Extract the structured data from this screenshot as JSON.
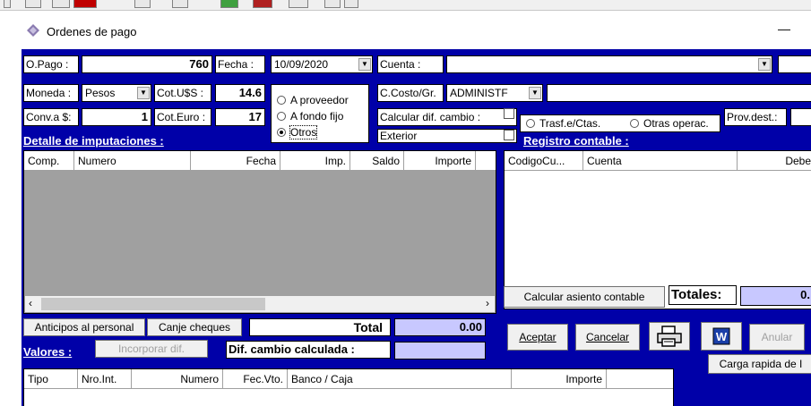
{
  "window": {
    "title": "Ordenes de pago",
    "minimize_glyph": "—"
  },
  "header": {
    "opago_label": "O.Pago :",
    "opago_value": "760",
    "fecha_label": "Fecha :",
    "fecha_value": "10/09/2020",
    "cuenta_label": "Cuenta :",
    "cuenta_value": "",
    "moneda_label": "Moneda :",
    "moneda_value": "Pesos",
    "cotus_label": "Cot.U$S :",
    "cotus_value": "14.6",
    "conv_label": "Conv.a $:",
    "conv_value": "1",
    "coteuro_label": "Cot.Euro :",
    "coteuro_value": "17",
    "ccosto_label": "C.Costo/Gr.",
    "ccosto_value": "ADMINISTF",
    "ccosto_desc": "",
    "calcular_label": "Calcular dif. cambio :",
    "exterior_label": "Exterior",
    "provdest_label": "Prov.dest.:"
  },
  "radio_group": {
    "options": [
      "A proveedor",
      "A fondo fijo",
      "Otros"
    ],
    "selected": "Otros"
  },
  "trasf_radio": {
    "opt1": "Trasf.e/Ctas.",
    "opt2": "Otras operac."
  },
  "sections": {
    "detalle": "Detalle de imputaciones :",
    "registro": "Registro contable :",
    "valores": "Valores :"
  },
  "imputaciones_grid": {
    "columns": [
      "Comp.",
      "Numero",
      "Fecha",
      "Imp.",
      "Saldo",
      "Importe"
    ]
  },
  "registro_grid": {
    "columns": [
      "CodigoCu...",
      "Cuenta",
      "Debe"
    ]
  },
  "valores_grid": {
    "columns": [
      "Tipo",
      "Nro.Int.",
      "Numero",
      "Fec.Vto.",
      "Banco / Caja",
      "Importe"
    ]
  },
  "buttons": {
    "anticipos": "Anticipos al personal",
    "canje": "Canje cheques",
    "incorporar": "Incorporar dif.",
    "calcular_asiento": "Calcular asiento contable",
    "aceptar": "Aceptar",
    "cancelar": "Cancelar",
    "anular": "Anular",
    "carga_rapida": "Carga rapida de I"
  },
  "totals": {
    "total_label": "Total",
    "total_value": "0.00",
    "dif_label": "Dif. cambio calculada :",
    "dif_value": "",
    "totales_label": "Totales:",
    "totales_value": "0."
  },
  "icons": {
    "app": "diamond-app-icon",
    "print": "printer-icon",
    "word": "word-icon"
  },
  "colors": {
    "background": "#0000a8",
    "highlight": "#c8c8ff"
  }
}
